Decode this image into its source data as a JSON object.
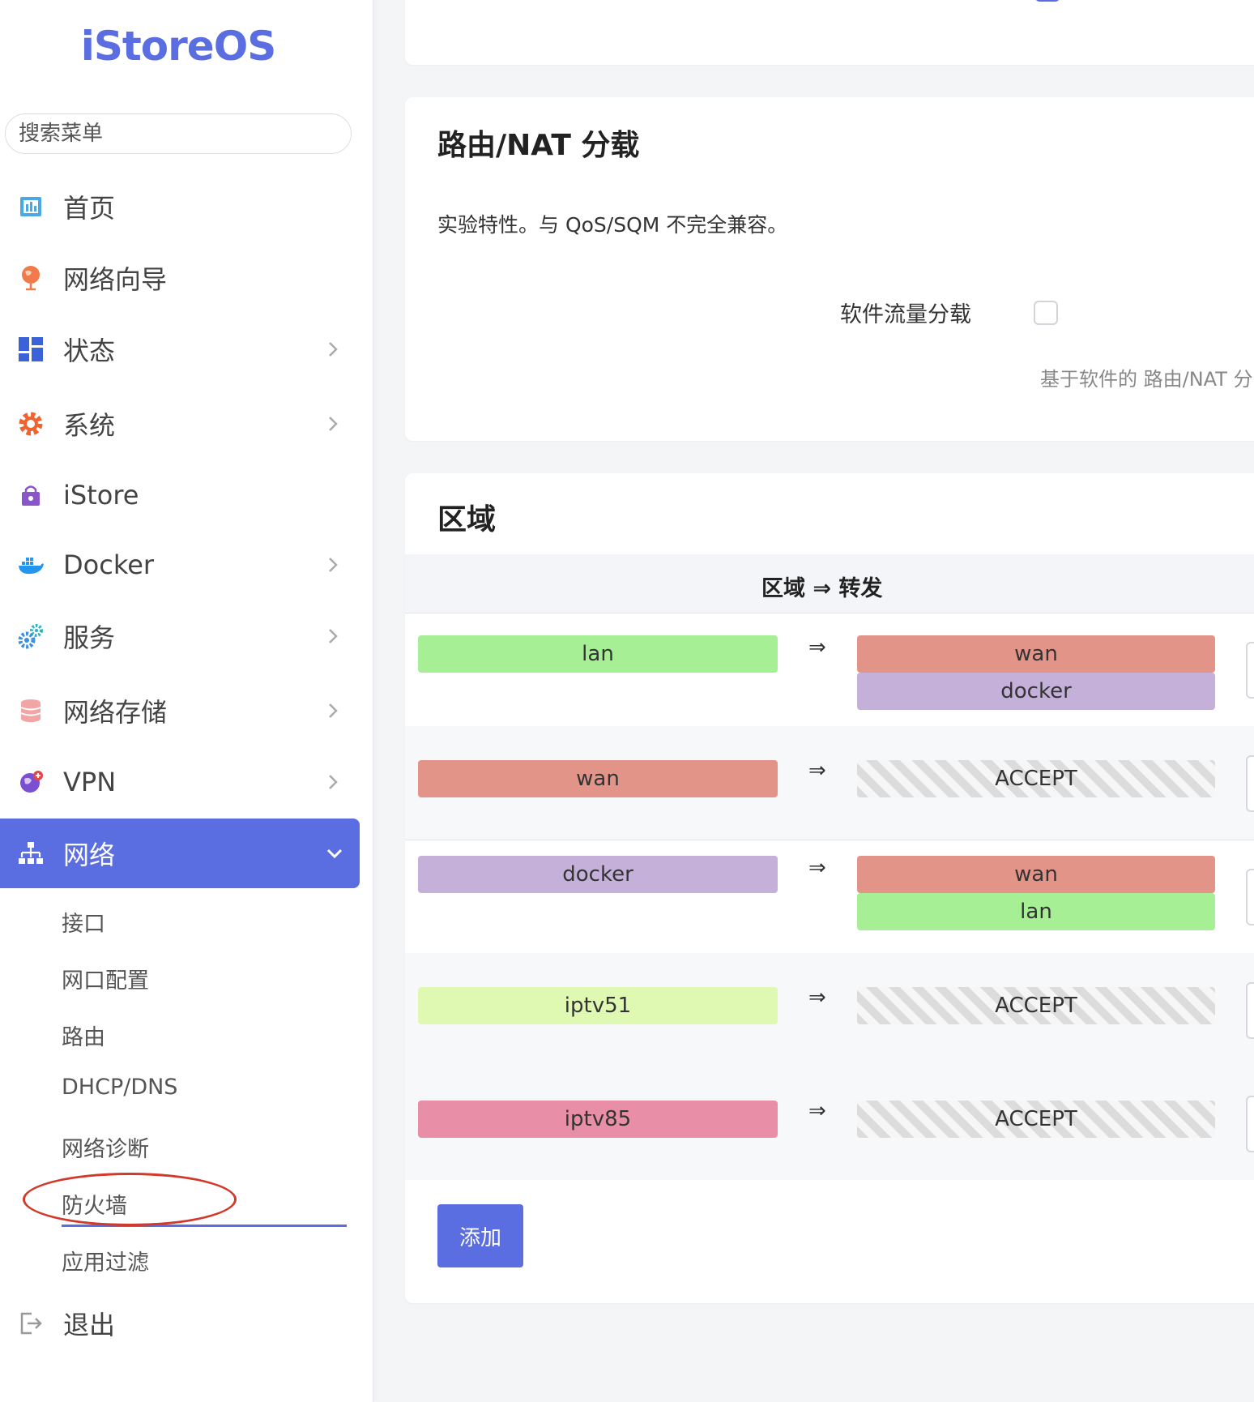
{
  "app": {
    "logo": "iStoreOS"
  },
  "sidebar": {
    "search_placeholder": "搜索菜单",
    "items": [
      {
        "label": "首页",
        "icon": "dashboard-icon"
      },
      {
        "label": "网络向导",
        "icon": "globe-icon"
      },
      {
        "label": "状态",
        "icon": "grid-icon"
      },
      {
        "label": "系统",
        "icon": "gear-icon"
      },
      {
        "label": "iStore",
        "icon": "bag-icon"
      },
      {
        "label": "Docker",
        "icon": "docker-icon"
      },
      {
        "label": "服务",
        "icon": "services-icon"
      },
      {
        "label": "网络存储",
        "icon": "database-icon"
      },
      {
        "label": "VPN",
        "icon": "vpn-icon"
      },
      {
        "label": "网络",
        "icon": "network-icon"
      },
      {
        "label": "退出",
        "icon": "logout-icon"
      }
    ],
    "network_submenu": [
      "接口",
      "网口配置",
      "路由",
      "DHCP/DNS",
      "网络诊断",
      "防火墙",
      "应用过滤"
    ]
  },
  "offload": {
    "title": "路由/NAT 分载",
    "description": "实验特性。与 QoS/SQM 不完全兼容。",
    "sw_label": "软件流量分载",
    "sw_hint": "基于软件的 路由/NAT 分"
  },
  "zones": {
    "title": "区域",
    "column_header": "区域 ⇒ 转发",
    "arrow": "⇒",
    "rows": [
      {
        "src": "lan",
        "dest": [
          "wan",
          "docker"
        ]
      },
      {
        "src": "wan",
        "dest": [
          "ACCEPT"
        ]
      },
      {
        "src": "docker",
        "dest": [
          "wan",
          "lan"
        ]
      },
      {
        "src": "iptv51",
        "dest": [
          "ACCEPT"
        ]
      },
      {
        "src": "iptv85",
        "dest": [
          "ACCEPT"
        ]
      }
    ],
    "add_label": "添加"
  },
  "colors": {
    "accent": "#5b6ee1",
    "lan": "#a6ef94",
    "wan": "#e39488",
    "docker": "#c5b0d9",
    "iptv51": "#dff9b2",
    "iptv85": "#e88ea6",
    "annotation_circle": "#d13a2a"
  }
}
